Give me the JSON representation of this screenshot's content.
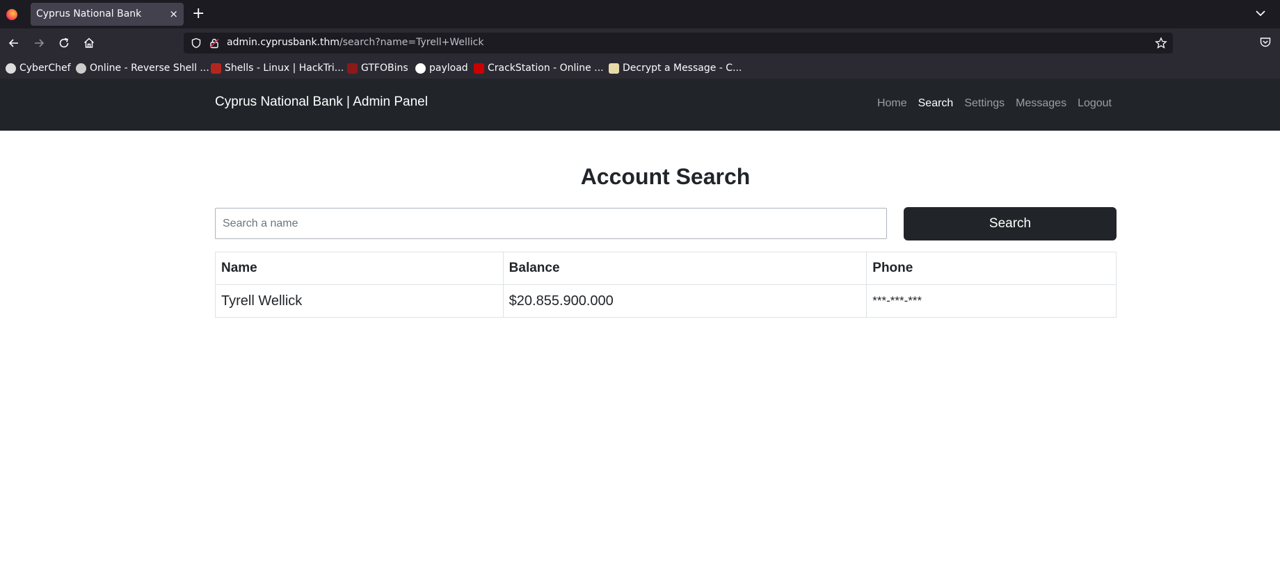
{
  "browser": {
    "tab_title": "Cyprus National Bank",
    "tab_close": "×",
    "new_tab": "+",
    "url_host": "admin.cyprusbank.thm",
    "url_path": "/search?name=Tyrell+Wellick",
    "bookmarks": [
      {
        "label": "CyberChef",
        "icon": "chef-hat-icon",
        "color": "#dddddd"
      },
      {
        "label": "Online - Reverse Shell ...",
        "icon": "skull-icon",
        "color": "#cccccc"
      },
      {
        "label": "Shells - Linux | HackTri...",
        "icon": "hacktricks-icon",
        "color": "#b3261e"
      },
      {
        "label": "GTFOBins",
        "icon": "gtfobins-icon",
        "color": "#8b1a1a"
      },
      {
        "label": "payload",
        "icon": "github-icon",
        "color": "#ffffff"
      },
      {
        "label": "CrackStation - Online ...",
        "icon": "crackstation-icon",
        "color": "#cc0000"
      },
      {
        "label": "Decrypt a Message - C...",
        "icon": "envelope-icon",
        "color": "#e8d9a8"
      }
    ]
  },
  "site": {
    "brand": "Cyprus National Bank | Admin Panel",
    "nav": [
      "Home",
      "Search",
      "Settings",
      "Messages",
      "Logout"
    ],
    "active_nav": "Search",
    "header_color": "#212529"
  },
  "main": {
    "title": "Account Search",
    "search_placeholder": "Search a name",
    "search_value": "",
    "search_button": "Search",
    "columns": [
      "Name",
      "Balance",
      "Phone"
    ],
    "rows": [
      {
        "name": "Tyrell Wellick",
        "balance": "$20.855.900.000",
        "phone": "***-***-***"
      }
    ]
  }
}
